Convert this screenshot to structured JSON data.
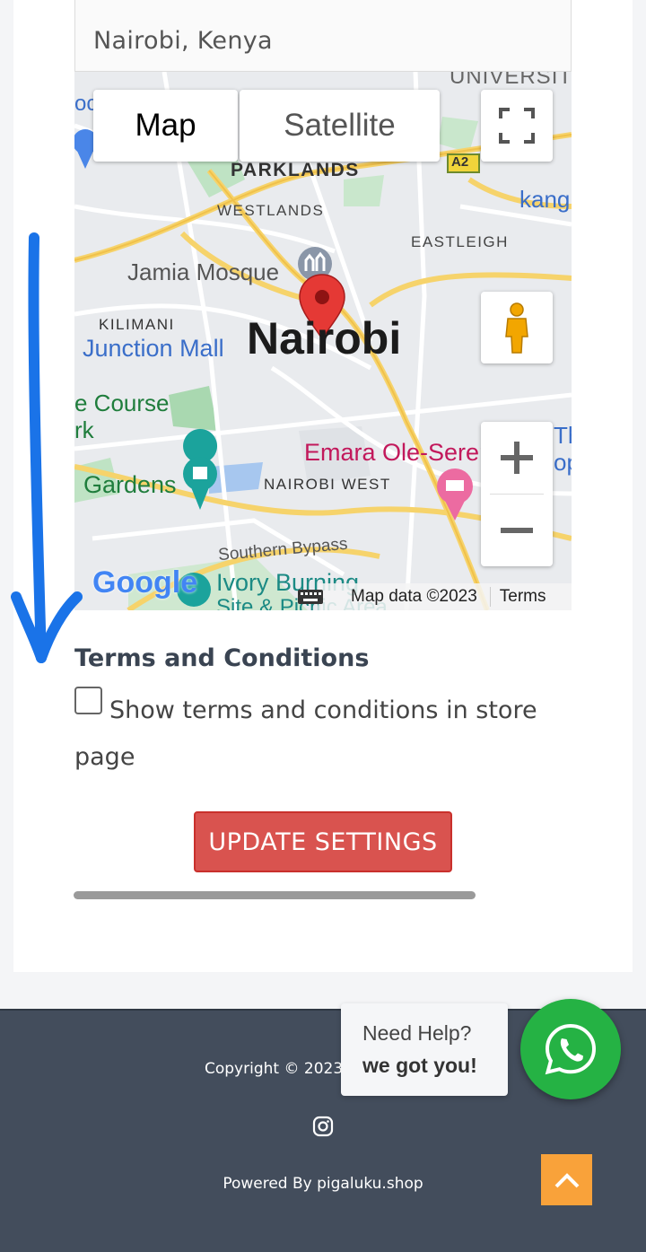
{
  "location": {
    "address_value": "Nairobi, Kenya"
  },
  "map": {
    "tabs": [
      "Map",
      "Satellite"
    ],
    "labels": {
      "university": "UNIVERSIT",
      "parklands": "PARKLANDS",
      "westlands": "WESTLANDS",
      "eastleigh": "EASTLEIGH",
      "jamia": "Jamia Mosque",
      "kilimani": "KILIMANI",
      "junction": "Junction Mall",
      "city": "Nairobi",
      "course": "e Course",
      "rk": "rk",
      "gardens": "Gardens",
      "nairobi_west": "NAIROBI WEST",
      "emara": "Emara Ole-Seren",
      "southern": "Southern Bypass",
      "ivory": "Ivory Burning",
      "site": "Site & Picnic Area",
      "kang": "kang",
      "a2": "A2",
      "oc": "oc",
      "th": "Th",
      "op": "op"
    },
    "logo": "Google",
    "map_data": "Map data ©2023",
    "terms": "Terms"
  },
  "terms_section": {
    "title": "Terms and Conditions",
    "checkbox_label": "Show terms and conditions in store page",
    "checked": false
  },
  "update_button": "UPDATE SETTINGS",
  "footer": {
    "copyright": "Copyright © 2023 |",
    "powered_by": "Powered By pigaluku.shop"
  },
  "help": {
    "line1": "Need Help?",
    "line2": "we got you!"
  },
  "colors": {
    "update_button": "#d9534f",
    "whatsapp": "#25b244",
    "scroll_top": "#f9a23a",
    "footer_bg": "#434d5c",
    "annotation_arrow": "#1a73e8"
  },
  "icons": [
    "fullscreen-icon",
    "pegman-icon",
    "zoom-in-icon",
    "zoom-out-icon",
    "keyboard-icon",
    "instagram-icon",
    "whatsapp-icon",
    "chevron-up-icon",
    "map-pin-icon"
  ]
}
